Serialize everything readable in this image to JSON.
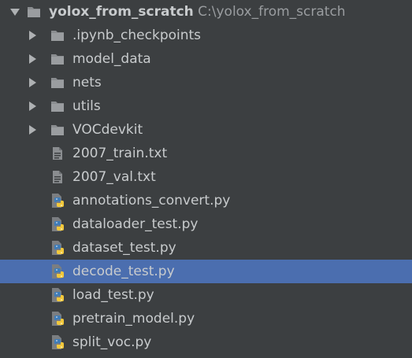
{
  "project_tree": {
    "root": {
      "name": "yolox_from_scratch",
      "path": "C:\\yolox_from_scratch",
      "icon": "folder-icon",
      "expanded": true
    },
    "items": [
      {
        "name": ".ipynb_checkpoints",
        "type": "folder",
        "icon": "folder-icon"
      },
      {
        "name": "model_data",
        "type": "folder",
        "icon": "folder-icon"
      },
      {
        "name": "nets",
        "type": "folder",
        "icon": "folder-icon"
      },
      {
        "name": "utils",
        "type": "folder",
        "icon": "folder-icon"
      },
      {
        "name": "VOCdevkit",
        "type": "folder",
        "icon": "folder-icon"
      },
      {
        "name": "2007_train.txt",
        "type": "text-file",
        "icon": "text-file-icon"
      },
      {
        "name": "2007_val.txt",
        "type": "text-file",
        "icon": "text-file-icon"
      },
      {
        "name": "annotations_convert.py",
        "type": "python-file",
        "icon": "python-file-icon"
      },
      {
        "name": "dataloader_test.py",
        "type": "python-file",
        "icon": "python-file-icon"
      },
      {
        "name": "dataset_test.py",
        "type": "python-file",
        "icon": "python-file-icon"
      },
      {
        "name": "decode_test.py",
        "type": "python-file",
        "icon": "python-file-icon",
        "selected": true
      },
      {
        "name": "load_test.py",
        "type": "python-file",
        "icon": "python-file-icon"
      },
      {
        "name": "pretrain_model.py",
        "type": "python-file",
        "icon": "python-file-icon"
      },
      {
        "name": "split_voc.py",
        "type": "python-file",
        "icon": "python-file-icon"
      }
    ]
  },
  "colors": {
    "background": "#3c3f41",
    "selection": "#4b6eaf",
    "text": "#c8cbcd",
    "path_text": "#9a9da0",
    "folder": "#8a8d90",
    "python_blue": "#3f7cb8",
    "python_yellow": "#f2c83b"
  }
}
